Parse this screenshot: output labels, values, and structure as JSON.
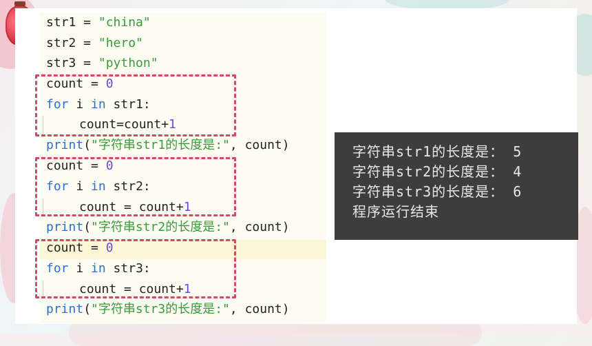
{
  "code_lines": [
    {
      "plain": "str1 = ",
      "str": "\"china\""
    },
    {
      "plain": "str2 = ",
      "str": "\"hero\""
    },
    {
      "plain": "str3 = ",
      "str": "\"python\""
    },
    {
      "plain": "count = ",
      "num": "0"
    },
    {
      "kw1": "for",
      "mid": " i ",
      "kw2": "in",
      "rest": " str1:"
    },
    {
      "body": "count=count+",
      "num": "1"
    },
    {
      "fn": "print",
      "p1": "(",
      "str": "\"字符串str1的长度是:\"",
      "rest": ", count)"
    },
    {
      "plain": "count = ",
      "num": "0"
    },
    {
      "kw1": "for",
      "mid": " i ",
      "kw2": "in",
      "rest": " str2:"
    },
    {
      "body": "count = count+",
      "num": "1"
    },
    {
      "fn": "print",
      "p1": "(",
      "str": "\"字符串str2的长度是:\"",
      "rest": ", count)"
    },
    {
      "plain": "count = ",
      "num": "0"
    },
    {
      "kw1": "for",
      "mid": " i ",
      "kw2": "in",
      "rest": " str3:"
    },
    {
      "body": "count = count+",
      "num": "1"
    },
    {
      "fn": "print",
      "p1": "(",
      "str": "\"字符串str3的长度是:\"",
      "rest": ", count)"
    }
  ],
  "console_lines": [
    "字符串str1的长度是： 5",
    "字符串str2的长度是： 4",
    "字符串str3的长度是： 6",
    "程序运行结束"
  ],
  "colors": {
    "keyword": "#2f6fd2",
    "string": "#3a9b3a",
    "number": "#6b4bd6",
    "dashed_box": "#d04a63",
    "console_bg": "#3d3d3d"
  }
}
